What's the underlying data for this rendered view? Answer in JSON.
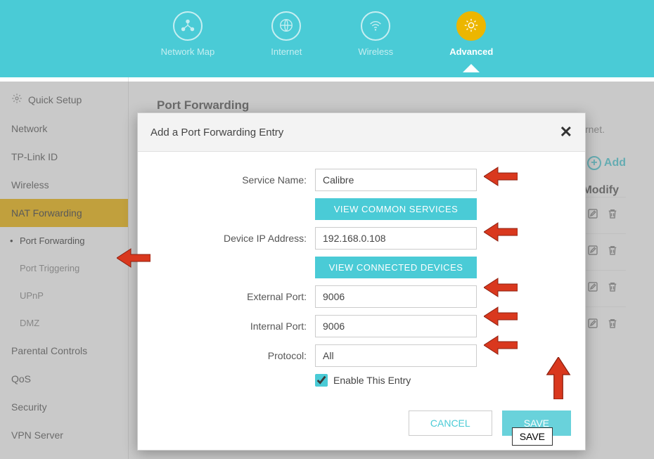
{
  "topnav": {
    "items": [
      {
        "label": "Network Map",
        "icon": "network-map-icon"
      },
      {
        "label": "Internet",
        "icon": "internet-icon"
      },
      {
        "label": "Wireless",
        "icon": "wireless-icon"
      },
      {
        "label": "Advanced",
        "icon": "advanced-icon"
      }
    ],
    "active_index": 3
  },
  "sidebar": {
    "items": [
      {
        "label": "Quick Setup",
        "icon": "gear-icon"
      },
      {
        "label": "Network"
      },
      {
        "label": "TP-Link ID"
      },
      {
        "label": "Wireless"
      },
      {
        "label": "NAT Forwarding",
        "selected": true,
        "children": [
          {
            "label": "Port Forwarding",
            "active": true
          },
          {
            "label": "Port Triggering"
          },
          {
            "label": "UPnP"
          },
          {
            "label": "DMZ"
          }
        ]
      },
      {
        "label": "Parental Controls"
      },
      {
        "label": "QoS"
      },
      {
        "label": "Security"
      },
      {
        "label": "VPN Server"
      }
    ]
  },
  "content": {
    "section_title": "Port Forwarding",
    "helper_text_fragment": "ernet.",
    "add_label": "Add",
    "table_head_modify": "Modify",
    "rows_count": 4
  },
  "modal": {
    "title": "Add a Port Forwarding Entry",
    "fields": {
      "service_name": {
        "label": "Service Name:",
        "value": "Calibre"
      },
      "view_services_btn": "VIEW COMMON SERVICES",
      "device_ip": {
        "label": "Device IP Address:",
        "value": "192.168.0.108"
      },
      "view_devices_btn": "VIEW CONNECTED DEVICES",
      "external_port": {
        "label": "External Port:",
        "value": "9006"
      },
      "internal_port": {
        "label": "Internal Port:",
        "value": "9006"
      },
      "protocol": {
        "label": "Protocol:",
        "value": "All"
      },
      "enable_label": "Enable This Entry",
      "enable_checked": true
    },
    "buttons": {
      "cancel": "CANCEL",
      "save": "SAVE"
    },
    "save_tooltip": "SAVE"
  },
  "colors": {
    "teal": "#4acbd6",
    "accent": "#ecb600",
    "sidebar_sel": "#f0b500",
    "arrow": "#d9381e"
  }
}
